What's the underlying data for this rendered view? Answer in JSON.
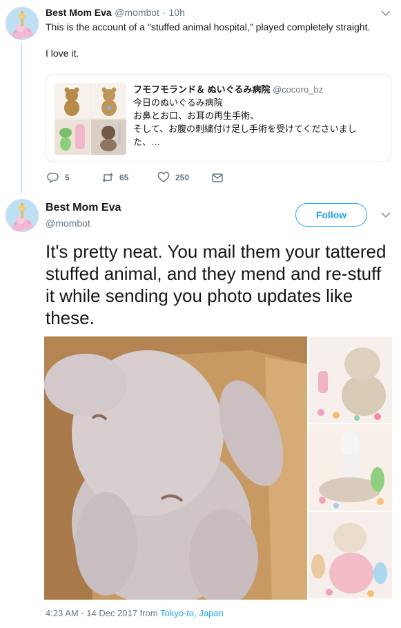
{
  "tweet1": {
    "name": "Best Mom Eva",
    "handle": "@mombot",
    "separator": "·",
    "time": "10h",
    "text_line1": "This is the account of a \"stuffed animal hospital,\" played completely straight.",
    "text_line2": "I love it.",
    "quote": {
      "name": "フモフモランド＆ ぬいぐるみ病院",
      "handle": "@cocoro_bz",
      "lines": [
        "今日のぬいぐるみ病院",
        "お鼻とお口、お耳の再生手術、",
        "そして、お腹の刺繍付け足し手術を受けてくださいまし",
        "た、…"
      ]
    },
    "actions": {
      "replies": "5",
      "retweets": "65",
      "likes": "250"
    }
  },
  "tweet2": {
    "name": "Best Mom Eva",
    "handle": "@mombot",
    "follow_label": "Follow",
    "text": "It's pretty neat. You mail them your tattered stuffed animal, and they mend and re-stuff it while sending you photo updates like these.",
    "timestamp": "4:23 AM - 14 Dec 2017 from ",
    "location": "Tokyo-to, Japan"
  },
  "icons": {
    "reply": "reply-icon",
    "retweet": "retweet-icon",
    "like": "heart-icon",
    "dm": "envelope-icon",
    "more": "chevron-down-icon"
  },
  "colors": {
    "brand_blue": "#1da1f2",
    "muted": "#657786",
    "thread_line": "#c4e4f7",
    "border": "#e1e8ed"
  }
}
